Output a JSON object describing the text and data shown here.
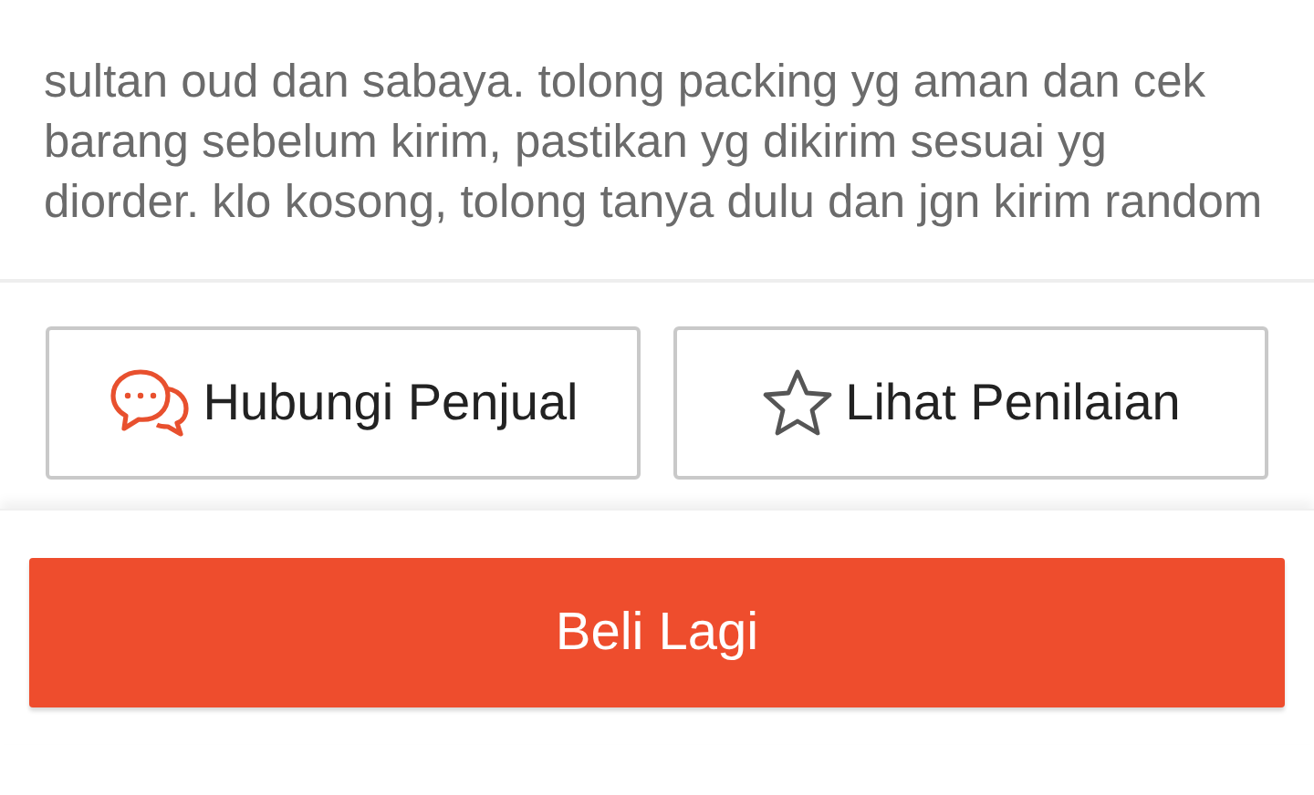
{
  "note": {
    "text": "sultan oud dan sabaya. tolong packing yg aman dan cek barang sebelum kirim, pastikan yg dikirim sesuai yg diorder. klo kosong, tolong tanya dulu dan jgn kirim random"
  },
  "actions": [
    {
      "kind": "chat",
      "label": "Hubungi Penjual"
    },
    {
      "kind": "star",
      "label": "Lihat Penilaian"
    }
  ],
  "primary_button": {
    "label": "Beli Lagi"
  }
}
